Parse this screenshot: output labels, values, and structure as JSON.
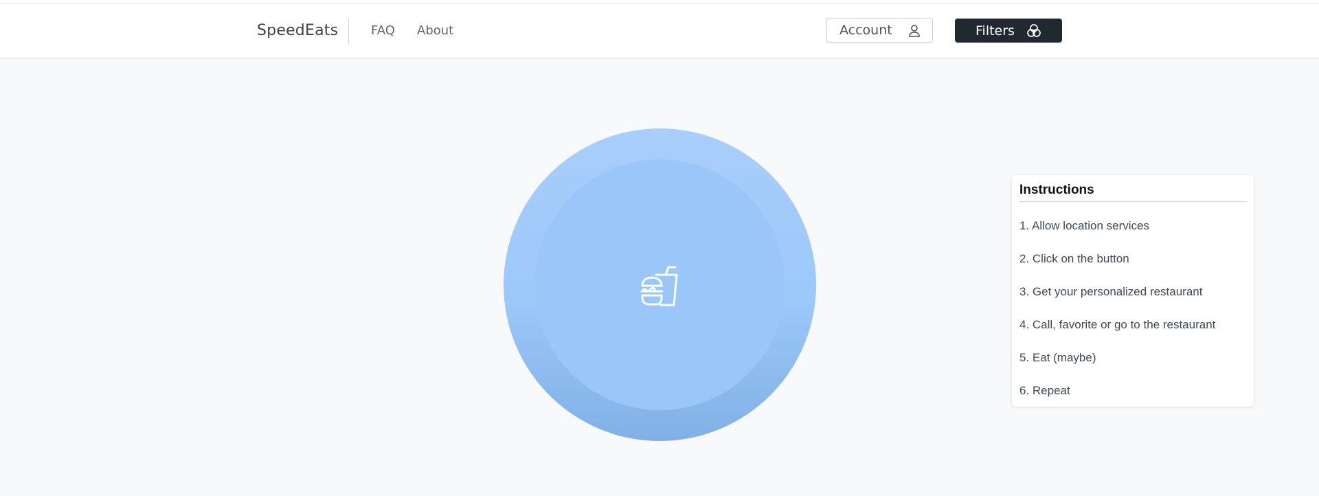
{
  "navbar": {
    "brand": "SpeedEats",
    "links": [
      {
        "label": "FAQ"
      },
      {
        "label": "About"
      }
    ],
    "account_button": {
      "label": "Account",
      "icon": "user-icon"
    },
    "filters_button": {
      "label": "Filters",
      "icon": "filter-circles-icon"
    }
  },
  "main": {
    "big_button": {
      "icon": "burger-drink-icon",
      "color": "#9cc8fa"
    }
  },
  "instructions": {
    "title": "Instructions",
    "steps": [
      "1. Allow location services",
      "2. Click on the button",
      "3. Get your personalized restaurant",
      "4. Call, favorite or go to the restaurant",
      "5. Eat (maybe)",
      "6. Repeat"
    ]
  },
  "colors": {
    "filters_bg": "#212830",
    "page_bg": "#f8f9fa"
  }
}
